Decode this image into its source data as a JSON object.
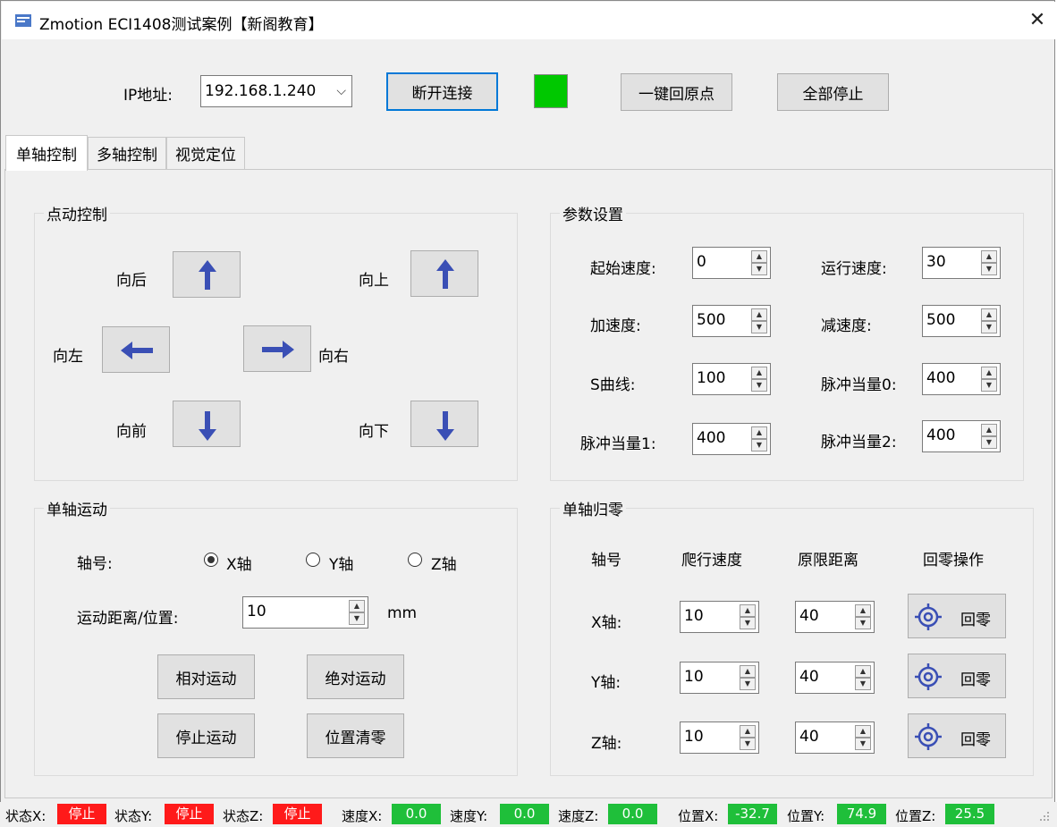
{
  "window": {
    "title": "Zmotion ECI1408测试案例【新阁教育】",
    "close_glyph": "✕"
  },
  "header": {
    "ip_label": "IP地址:",
    "ip_value": "192.168.1.240",
    "disconnect_label": "断开连接",
    "connection_indicator_color": "#00c800",
    "home_all_label": "一键回原点",
    "stop_all_label": "全部停止"
  },
  "tabs": [
    {
      "label": "单轴控制",
      "active": true
    },
    {
      "label": "多轴控制",
      "active": false
    },
    {
      "label": "视觉定位",
      "active": false
    }
  ],
  "jog": {
    "title": "点动控制",
    "back_label": "向后",
    "up_label": "向上",
    "left_label": "向左",
    "right_label": "向右",
    "front_label": "向前",
    "down_label": "向下",
    "arrow_color": "#3a4fb5"
  },
  "params": {
    "title": "参数设置",
    "fields": [
      {
        "label": "起始速度:",
        "value": "0"
      },
      {
        "label": "运行速度:",
        "value": "30"
      },
      {
        "label": "加速度:",
        "value": "500"
      },
      {
        "label": "减速度:",
        "value": "500"
      },
      {
        "label": "S曲线:",
        "value": "100"
      },
      {
        "label": "脉冲当量0:",
        "value": "400"
      },
      {
        "label": "脉冲当量1:",
        "value": "400"
      },
      {
        "label": "脉冲当量2:",
        "value": "400"
      }
    ]
  },
  "single_axis": {
    "title": "单轴运动",
    "axis_label": "轴号:",
    "axes": [
      {
        "label": "X轴",
        "checked": true
      },
      {
        "label": "Y轴",
        "checked": false
      },
      {
        "label": "Z轴",
        "checked": false
      }
    ],
    "distance_label": "运动距离/位置:",
    "distance_value": "10",
    "unit": "mm",
    "relative_label": "相对运动",
    "absolute_label": "绝对运动",
    "stop_label": "停止运动",
    "clear_label": "位置清零"
  },
  "homing": {
    "title": "单轴归零",
    "headers": [
      "轴号",
      "爬行速度",
      "原限距离",
      "回零操作"
    ],
    "rows": [
      {
        "axis": "X轴:",
        "speed": "10",
        "distance": "40",
        "button": "回零"
      },
      {
        "axis": "Y轴:",
        "speed": "10",
        "distance": "40",
        "button": "回零"
      },
      {
        "axis": "Z轴:",
        "speed": "10",
        "distance": "40",
        "button": "回零"
      }
    ]
  },
  "status": {
    "state_x_label": "状态X:",
    "state_x": "停止",
    "state_y_label": "状态Y:",
    "state_y": "停止",
    "state_z_label": "状态Z:",
    "state_z": "停止",
    "speed_x_label": "速度X:",
    "speed_x": "0.0",
    "speed_y_label": "速度Y:",
    "speed_y": "0.0",
    "speed_z_label": "速度Z:",
    "speed_z": "0.0",
    "pos_x_label": "位置X:",
    "pos_x": "-32.7",
    "pos_y_label": "位置Y:",
    "pos_y": "74.9",
    "pos_z_label": "位置Z:",
    "pos_z": "25.5",
    "stop_color": "#ff1a1a",
    "value_color": "#1fbf3a"
  }
}
